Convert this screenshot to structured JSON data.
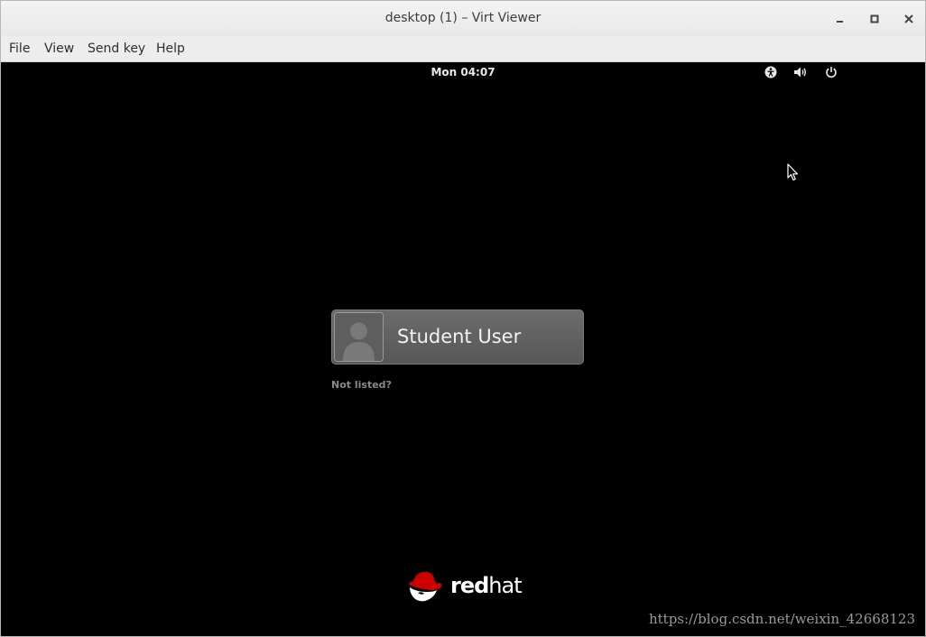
{
  "window": {
    "title": "desktop (1) – Virt Viewer"
  },
  "menu": {
    "items": [
      "File",
      "View",
      "Send key",
      "Help"
    ]
  },
  "topbar": {
    "clock": "Mon 04:07",
    "icons": [
      "accessibility-icon",
      "volume-icon",
      "power-icon"
    ]
  },
  "login": {
    "user_name": "Student User",
    "not_listed": "Not listed?"
  },
  "branding": {
    "logo_regular": "hat",
    "logo_bold": "red"
  },
  "watermark": "https://blog.csdn.net/weixin_42668123",
  "colors": {
    "accent_red": "#cc0000",
    "background": "#000000"
  }
}
